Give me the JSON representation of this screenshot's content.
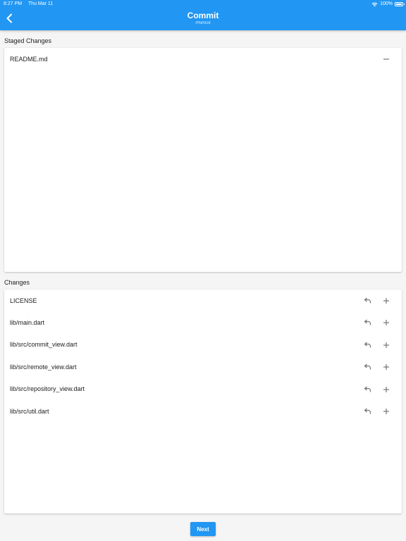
{
  "status_bar": {
    "time": "8:27 PM",
    "date": "Thu Mar 11",
    "battery": "100%"
  },
  "app_bar": {
    "title": "Commit",
    "subtitle": "PhimGit",
    "back_icon": "chevron-left-icon"
  },
  "staged": {
    "label": "Staged Changes",
    "items": [
      {
        "name": "README.md",
        "action_icon": "minus-icon"
      }
    ]
  },
  "changes": {
    "label": "Changes",
    "items": [
      {
        "name": "LICENSE",
        "undo_icon": "undo-icon",
        "add_icon": "plus-icon"
      },
      {
        "name": "lib/main.dart",
        "undo_icon": "undo-icon",
        "add_icon": "plus-icon"
      },
      {
        "name": "lib/src/commit_view.dart",
        "undo_icon": "undo-icon",
        "add_icon": "plus-icon"
      },
      {
        "name": "lib/src/remote_view.dart",
        "undo_icon": "undo-icon",
        "add_icon": "plus-icon"
      },
      {
        "name": "lib/src/repository_view.dart",
        "undo_icon": "undo-icon",
        "add_icon": "plus-icon"
      },
      {
        "name": "lib/src/util.dart",
        "undo_icon": "undo-icon",
        "add_icon": "plus-icon"
      }
    ]
  },
  "footer": {
    "next_label": "Next"
  },
  "colors": {
    "accent": "#2196f3",
    "background": "#f5f5f5",
    "card": "#ffffff",
    "icon": "#757575"
  }
}
